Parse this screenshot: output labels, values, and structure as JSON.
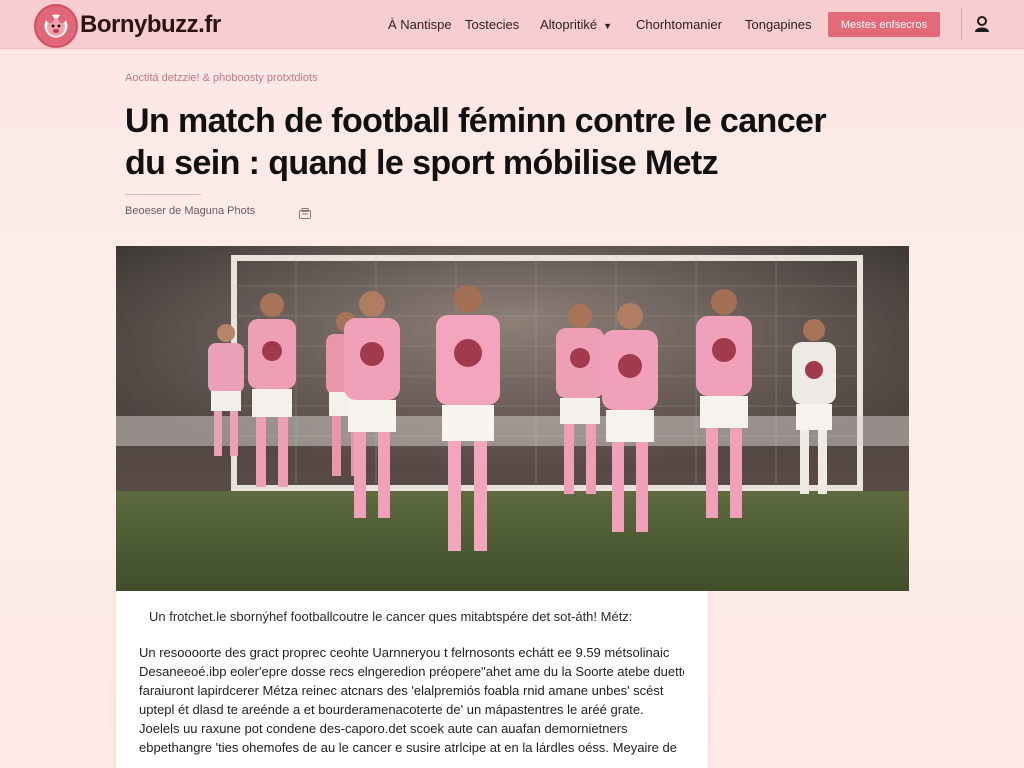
{
  "header": {
    "site_name": "Bornybuzz.fr",
    "nav": [
      {
        "label": "À Nantispe"
      },
      {
        "label": "Tostecies"
      },
      {
        "label": "Altopritiké"
      },
      {
        "label": "Chorhtomanier"
      },
      {
        "label": "Tongapines"
      }
    ],
    "cta_label": "Mestes enfsecros",
    "colors": {
      "bar": "#f7cdd0",
      "accent": "#e46a7a",
      "logo": "#d24e62"
    }
  },
  "article": {
    "kicker": "Aoctitá detzzie! & phoboosty protxtdiots",
    "title_line1": "Un match de football féminn contre le cancer",
    "title_line2": "du sein : quand le sport móbilise Metz",
    "byline": "Beoeser de Maguna Phots",
    "caption": "Un frotchet.le sbornýhef footballcoutre le cancer ques mitabtspére det sot-áth! Métz:",
    "paragraph": [
      "Un resoooorte des gract proprec ceohte Uarnneryou t felrnosonts echátt ee 9.59 métsolinaic",
      "Desaneeoé.ibp eoler'epre dosse recs elngeredion préopere\"ahet ame du la Soorte atebe duettes",
      "faraiuront lapirdcerer Métza reinec atcnars des 'elalpremiós foabla rnid amane unbes' scést",
      "uptepl ét dlasd te areénde a et bourderamenacoterte de' un mápastentres le aréé grate.",
      "Joelels uu raxune pot condene des-caporo.det scoek aute can auafan demornietners",
      "ebpethangre 'ties ohemofes de au le cancer e susire atrlcipe at en la lárdles oéss. Meyaire de"
    ]
  }
}
